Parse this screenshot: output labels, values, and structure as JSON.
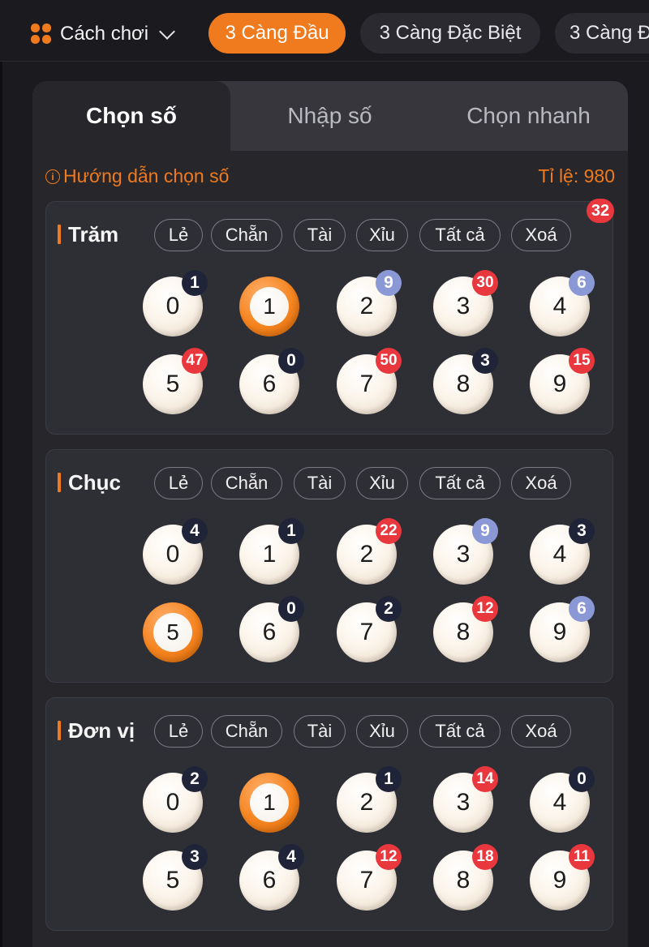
{
  "header": {
    "howto_label": "Cách chơi",
    "game_tabs": [
      {
        "label": "3 Càng Đầu",
        "active": true
      },
      {
        "label": "3 Càng Đặc Biệt",
        "active": false
      },
      {
        "label": "3 Càng Đ",
        "active": false
      }
    ]
  },
  "mode_tabs": [
    {
      "label": "Chọn số",
      "active": true
    },
    {
      "label": "Nhập số",
      "active": false
    },
    {
      "label": "Chọn nhanh",
      "active": false
    }
  ],
  "guide_label": "Hướng dẫn chọn số",
  "rate_label": "Tỉ lệ:",
  "rate_value": "980",
  "colors": {
    "accent": "#f07a1e",
    "badge_red": "#e8383d",
    "badge_dark": "#1f2438",
    "badge_blue": "#8a99d6"
  },
  "filters": [
    "Lẻ",
    "Chẵn",
    "Tài",
    "Xỉu",
    "Tất cả",
    "Xoá"
  ],
  "sections": [
    {
      "title": "Trăm",
      "badge": "32",
      "balls": [
        {
          "n": "0",
          "count": "1",
          "tone": "dark",
          "selected": false
        },
        {
          "n": "1",
          "count": "",
          "tone": "",
          "selected": true
        },
        {
          "n": "2",
          "count": "9",
          "tone": "blue",
          "selected": false
        },
        {
          "n": "3",
          "count": "30",
          "tone": "red",
          "selected": false
        },
        {
          "n": "4",
          "count": "6",
          "tone": "blue",
          "selected": false
        },
        {
          "n": "5",
          "count": "47",
          "tone": "red",
          "selected": false
        },
        {
          "n": "6",
          "count": "0",
          "tone": "dark",
          "selected": false
        },
        {
          "n": "7",
          "count": "50",
          "tone": "red",
          "selected": false
        },
        {
          "n": "8",
          "count": "3",
          "tone": "dark",
          "selected": false
        },
        {
          "n": "9",
          "count": "15",
          "tone": "red",
          "selected": false
        }
      ]
    },
    {
      "title": "Chục",
      "badge": "",
      "balls": [
        {
          "n": "0",
          "count": "4",
          "tone": "dark",
          "selected": false
        },
        {
          "n": "1",
          "count": "1",
          "tone": "dark",
          "selected": false
        },
        {
          "n": "2",
          "count": "22",
          "tone": "red",
          "selected": false
        },
        {
          "n": "3",
          "count": "9",
          "tone": "blue",
          "selected": false
        },
        {
          "n": "4",
          "count": "3",
          "tone": "dark",
          "selected": false
        },
        {
          "n": "5",
          "count": "",
          "tone": "",
          "selected": true
        },
        {
          "n": "6",
          "count": "0",
          "tone": "dark",
          "selected": false
        },
        {
          "n": "7",
          "count": "2",
          "tone": "dark",
          "selected": false
        },
        {
          "n": "8",
          "count": "12",
          "tone": "red",
          "selected": false
        },
        {
          "n": "9",
          "count": "6",
          "tone": "blue",
          "selected": false
        }
      ]
    },
    {
      "title": "Đơn vị",
      "badge": "",
      "balls": [
        {
          "n": "0",
          "count": "2",
          "tone": "dark",
          "selected": false
        },
        {
          "n": "1",
          "count": "",
          "tone": "",
          "selected": true
        },
        {
          "n": "2",
          "count": "1",
          "tone": "dark",
          "selected": false
        },
        {
          "n": "3",
          "count": "14",
          "tone": "red",
          "selected": false
        },
        {
          "n": "4",
          "count": "0",
          "tone": "dark",
          "selected": false
        },
        {
          "n": "5",
          "count": "3",
          "tone": "dark",
          "selected": false
        },
        {
          "n": "6",
          "count": "4",
          "tone": "dark",
          "selected": false
        },
        {
          "n": "7",
          "count": "12",
          "tone": "red",
          "selected": false
        },
        {
          "n": "8",
          "count": "18",
          "tone": "red",
          "selected": false
        },
        {
          "n": "9",
          "count": "11",
          "tone": "red",
          "selected": false
        }
      ]
    }
  ]
}
